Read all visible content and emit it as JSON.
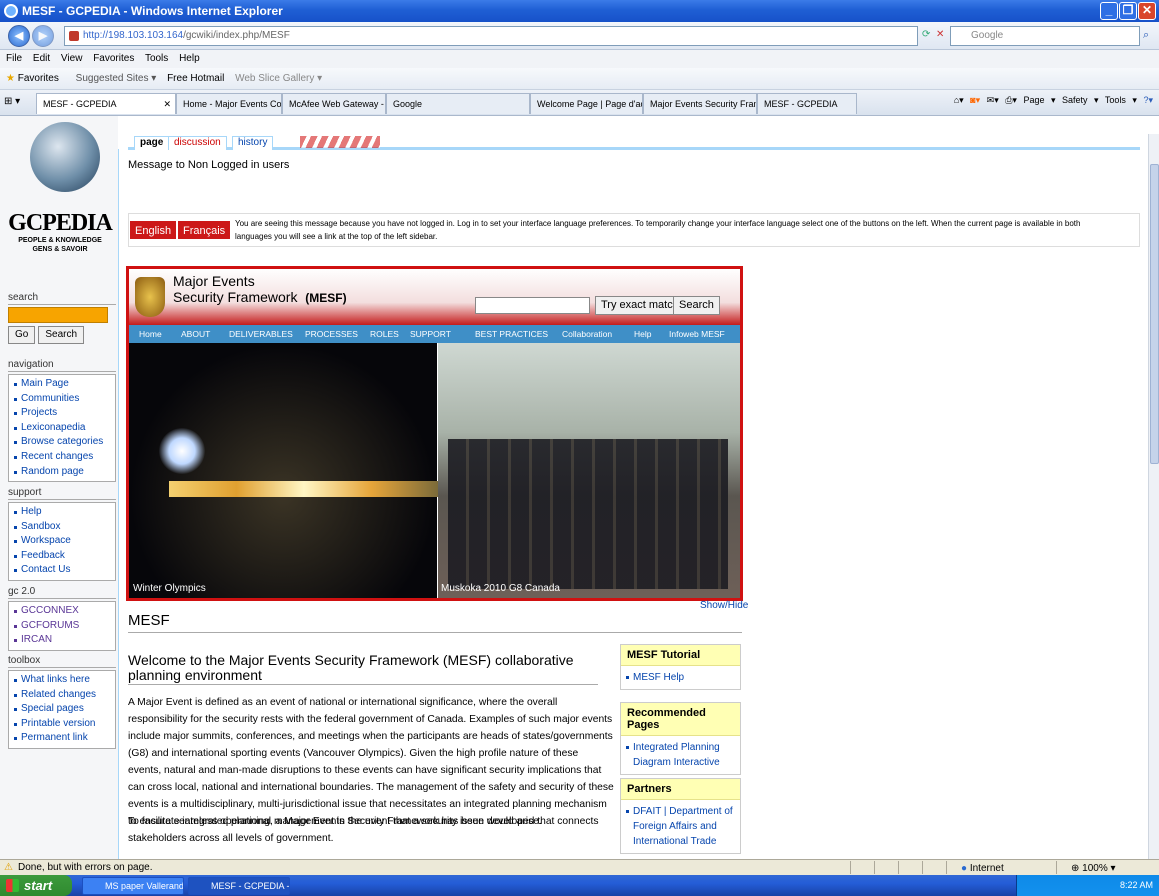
{
  "window": {
    "title": "MESF - GCPEDIA - Windows Internet Explorer"
  },
  "address": {
    "url_host": "http://198.103.103.164",
    "url_path": "/gcwiki/index.php/MESF",
    "search_placeholder": "Google"
  },
  "menu": [
    "File",
    "Edit",
    "View",
    "Favorites",
    "Tools",
    "Help"
  ],
  "favorites": {
    "label": "Favorites",
    "items": [
      "Suggested Sites ▾",
      "Free Hotmail",
      "Web Slice Gallery ▾"
    ]
  },
  "tabs": [
    {
      "label": "MESF - GCPEDIA",
      "active": true
    },
    {
      "label": "Home - Major Events Coordi..."
    },
    {
      "label": "McAfee Web Gateway - Noti..."
    },
    {
      "label": "Google"
    },
    {
      "label": "Welcome Page | Page d'accueil"
    },
    {
      "label": "Major Events Security Frame..."
    },
    {
      "label": "MESF - GCPEDIA"
    }
  ],
  "commandbar": {
    "page": "Page ▾",
    "safety": "Safety ▾",
    "tools": "Tools ▾"
  },
  "wiki": {
    "logo": {
      "title": "GCPEDIA",
      "sub1": "PEOPLE & KNOWLEDGE",
      "sub2": "GENS & SAVOIR"
    },
    "page_tabs": [
      "page",
      "discussion",
      "history"
    ],
    "search": {
      "heading": "search",
      "go": "Go",
      "search": "Search"
    },
    "navigation": {
      "heading": "navigation",
      "items": [
        "Main Page",
        "Communities",
        "Projects",
        "Lexiconapedia",
        "Browse categories",
        "Recent changes",
        "Random page"
      ]
    },
    "support": {
      "heading": "support",
      "items": [
        "Help",
        "Sandbox",
        "Workspace",
        "Feedback",
        "Contact Us"
      ]
    },
    "gc20": {
      "heading": "gc 2.0",
      "items": [
        "GCCONNEX",
        "GCFORUMS",
        "IRCAN"
      ]
    },
    "toolbox": {
      "heading": "toolbox",
      "items": [
        "What links here",
        "Related changes",
        "Special pages",
        "Printable version",
        "Permanent link"
      ]
    },
    "not_logged_msg": "Message to Non Logged in users",
    "lang": {
      "english": "English",
      "francais": "Français",
      "text": "You are seeing this message because you have not logged in. Log in to set your interface language preferences. To temporarily change your interface language select one of the buttons on the left. When the current page is available in both languages you will see a link at the top of the left sidebar."
    }
  },
  "banner": {
    "title1": "Major Events",
    "title2": "Security Framework",
    "title2b": "(MESF)",
    "try_exact": "Try exact match",
    "search": "Search",
    "nav": [
      "Home",
      "ABOUT",
      "DELIVERABLES",
      "PROCESSES",
      "ROLES",
      "SUPPORT",
      "BEST PRACTICES",
      "Collaboration",
      "Help",
      "Infoweb MESF"
    ],
    "caption_left": "Winter Olympics",
    "caption_right": "Muskoka 2010 G8 Canada"
  },
  "article": {
    "show_hide": "Show/Hide",
    "heading": "MESF",
    "welcome": "Welcome to the Major Events Security Framework (MESF) collaborative planning environment",
    "para1": "A Major Event is defined as an event of national or international significance, where the overall responsibility for the security rests with the federal government of Canada. Examples of such major events include major summits, conferences, and meetings when the participants are heads of states/governments (G8) and international sporting events (Vancouver Olympics). Given the high profile nature of these events, natural and man-made disruptions to these events can have significant security implications that can cross local, national and international boundaries. The management of the safety and security of these events is a multidisciplinary, multi-jurisdictional issue that necessitates an integrated planning mechanism to ensure seamless operational management in the event that a security issue would arise.",
    "para2": "To facilitate integrated planning, a Major Events Security Framework has been developed that connects stakeholders across all levels of government.",
    "boxes": [
      {
        "title": "MESF Tutorial",
        "items": [
          "MESF Help"
        ]
      },
      {
        "title": "Recommended Pages",
        "items": [
          "Integrated Planning Diagram Interactive"
        ]
      },
      {
        "title": "Partners",
        "items": [
          "DFAIT | Department of Foreign Affairs and International Trade"
        ]
      }
    ]
  },
  "status": {
    "text": "Done, but with errors on page.",
    "zone": "Internet",
    "zoom": "100%"
  },
  "taskbar": {
    "start": "start",
    "items": [
      "MS paper Vallerand M...",
      "MESF - GCPEDIA - Wi..."
    ],
    "time": "8:22 AM"
  }
}
